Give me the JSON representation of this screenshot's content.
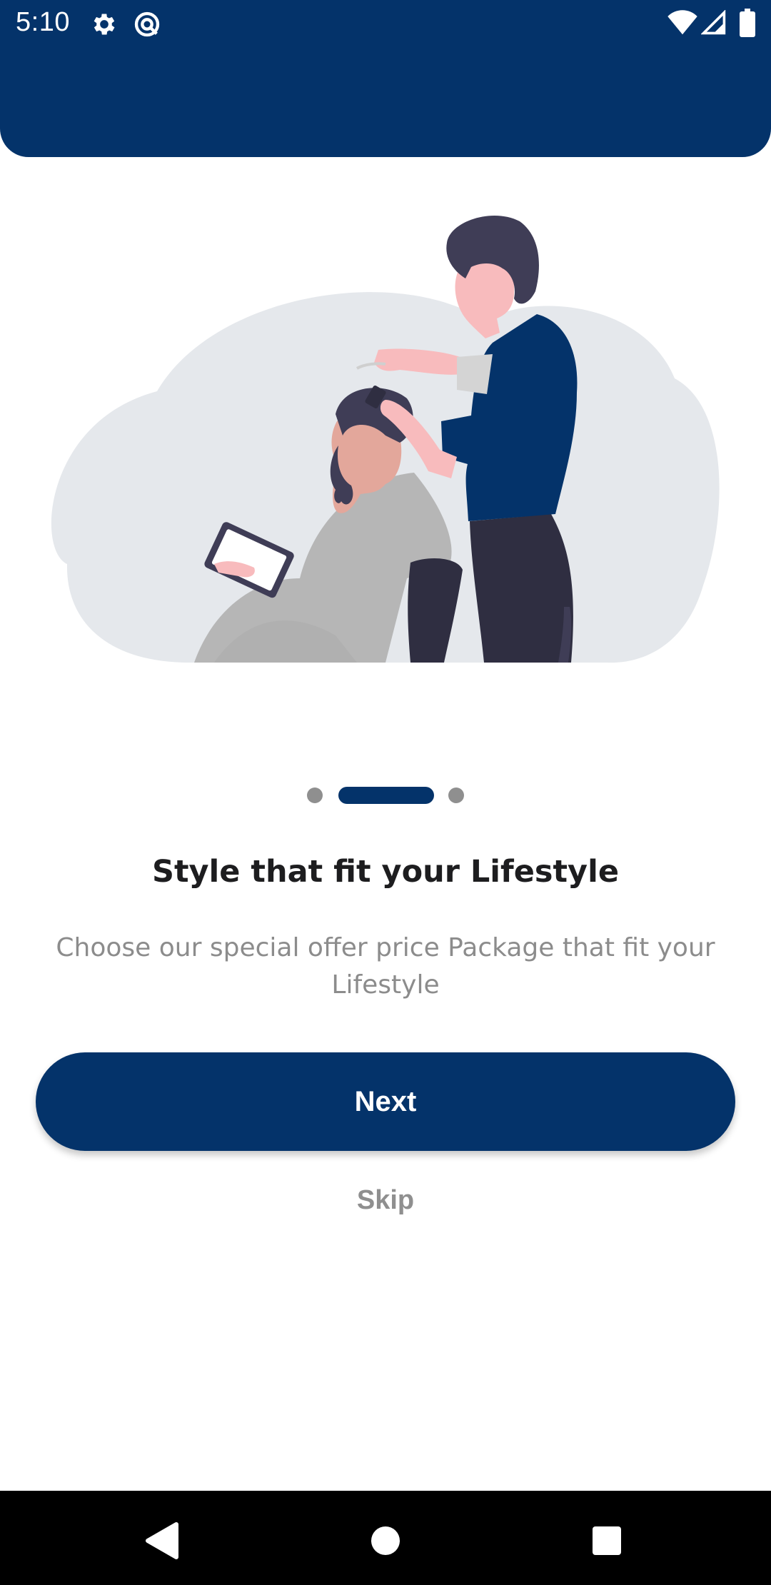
{
  "status_bar": {
    "time": "5:10",
    "left_icons": [
      "gear-icon",
      "sync-icon"
    ],
    "right_icons": [
      "wifi-icon",
      "signal-icon",
      "battery-icon"
    ]
  },
  "colors": {
    "primary": "#04336a",
    "title": "#1d1d1f",
    "subtitle": "#8c8c8c",
    "dot_inactive": "#8f8f8f",
    "illustration_cloud": "#e5e8ec",
    "illustration_shirt": "#04336a",
    "illustration_hair": "#3f3d56",
    "illustration_skin": "#f8bbbd",
    "illustration_cape": "#b6b6b6",
    "illustration_pants": "#2f2e41"
  },
  "illustration": {
    "icon": "barber-illustration"
  },
  "pager": {
    "total_pages": 3,
    "current_page": 2
  },
  "onboarding": {
    "title": "Style that fit your Lifestyle",
    "subtitle": "Choose our special offer price Package that fit your Lifestyle"
  },
  "actions": {
    "next_label": "Next",
    "skip_label": "Skip"
  },
  "nav_bar": {
    "icons": [
      "back-icon",
      "home-icon",
      "recents-icon"
    ]
  }
}
